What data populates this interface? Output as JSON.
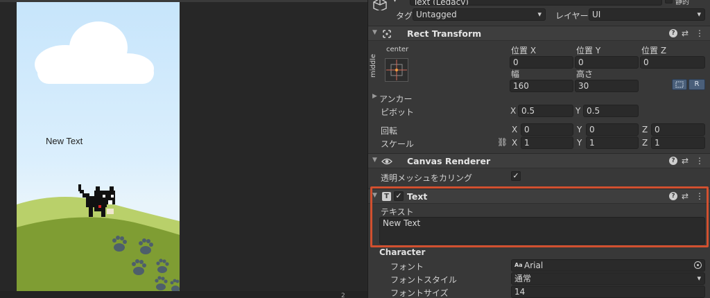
{
  "object": {
    "name": "Text (Legacy)",
    "static_label": "静的",
    "tag_label": "タグ",
    "tag_value": "Untagged",
    "layer_label": "レイヤー",
    "layer_value": "UI"
  },
  "rect_transform": {
    "title": "Rect Transform",
    "anchor_h": "center",
    "anchor_v": "middle",
    "pos_x_label": "位置 X",
    "pos_y_label": "位置 Y",
    "pos_z_label": "位置 Z",
    "pos_x": "0",
    "pos_y": "0",
    "pos_z": "0",
    "width_label": "幅",
    "height_label": "高さ",
    "width": "160",
    "height": "30",
    "raw_button": "R",
    "anchor_label": "アンカー",
    "pivot_label": "ピボット",
    "pivot_x": "0.5",
    "pivot_y": "0.5",
    "rotation_label": "回転",
    "rot_x": "0",
    "rot_y": "0",
    "rot_z": "0",
    "scale_label": "スケール",
    "scale_x": "1",
    "scale_y": "1",
    "scale_z": "1",
    "axis_x": "X",
    "axis_y": "Y",
    "axis_z": "Z"
  },
  "canvas_renderer": {
    "title": "Canvas Renderer",
    "cull_label": "透明メッシュをカリング"
  },
  "text_component": {
    "title": "Text",
    "text_label": "テキスト",
    "text_value": "New Text",
    "character_label": "Character",
    "font_label": "フォント",
    "font_value": "Arial",
    "font_prefix": "Aa",
    "style_label": "フォントスタイル",
    "style_value": "通常",
    "size_label": "フォントサイズ",
    "size_value": "14"
  },
  "scene": {
    "game_text": "New Text",
    "corner_label": "2"
  },
  "colors": {
    "highlight": "#d2502f",
    "sky": "#c7e5fb",
    "grass": "#8aaa3a",
    "paw": "#4e5f6b"
  }
}
